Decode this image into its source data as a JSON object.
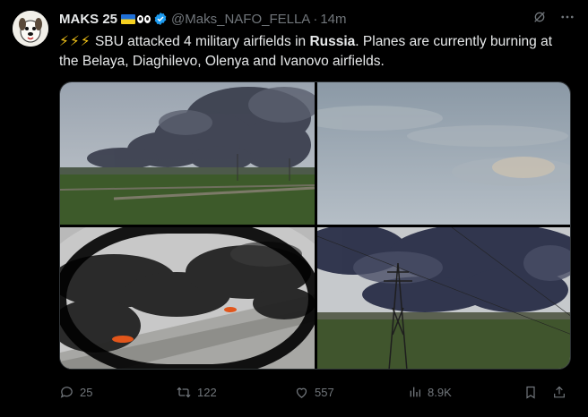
{
  "post": {
    "author_name": "MAKS 25",
    "handle": "@Maks_NAFO_FELLA",
    "separator": "·",
    "time": "14m",
    "text_lead": "SBU attacked 4 military airfields in ",
    "text_bold": "Russia",
    "text_tail": ". Planes are currently burning at the Belaya, Diaghilevo, Olenya and Ivanovo airfields.",
    "bolt_emojis": "⚡⚡⚡"
  },
  "actions": {
    "replies": "25",
    "reposts": "122",
    "likes": "557",
    "views": "8.9K"
  },
  "icons": {
    "verified": "verified-badge-icon",
    "grok": "grok-icon",
    "more": "more-icon",
    "reply": "reply-icon",
    "repost": "repost-icon",
    "like": "heart-icon",
    "views": "views-icon",
    "bookmark": "bookmark-icon",
    "share": "share-icon"
  },
  "colors": {
    "background": "#000000",
    "text": "#e7e9ea",
    "muted": "#71767b",
    "verified": "#1d9bf0"
  }
}
